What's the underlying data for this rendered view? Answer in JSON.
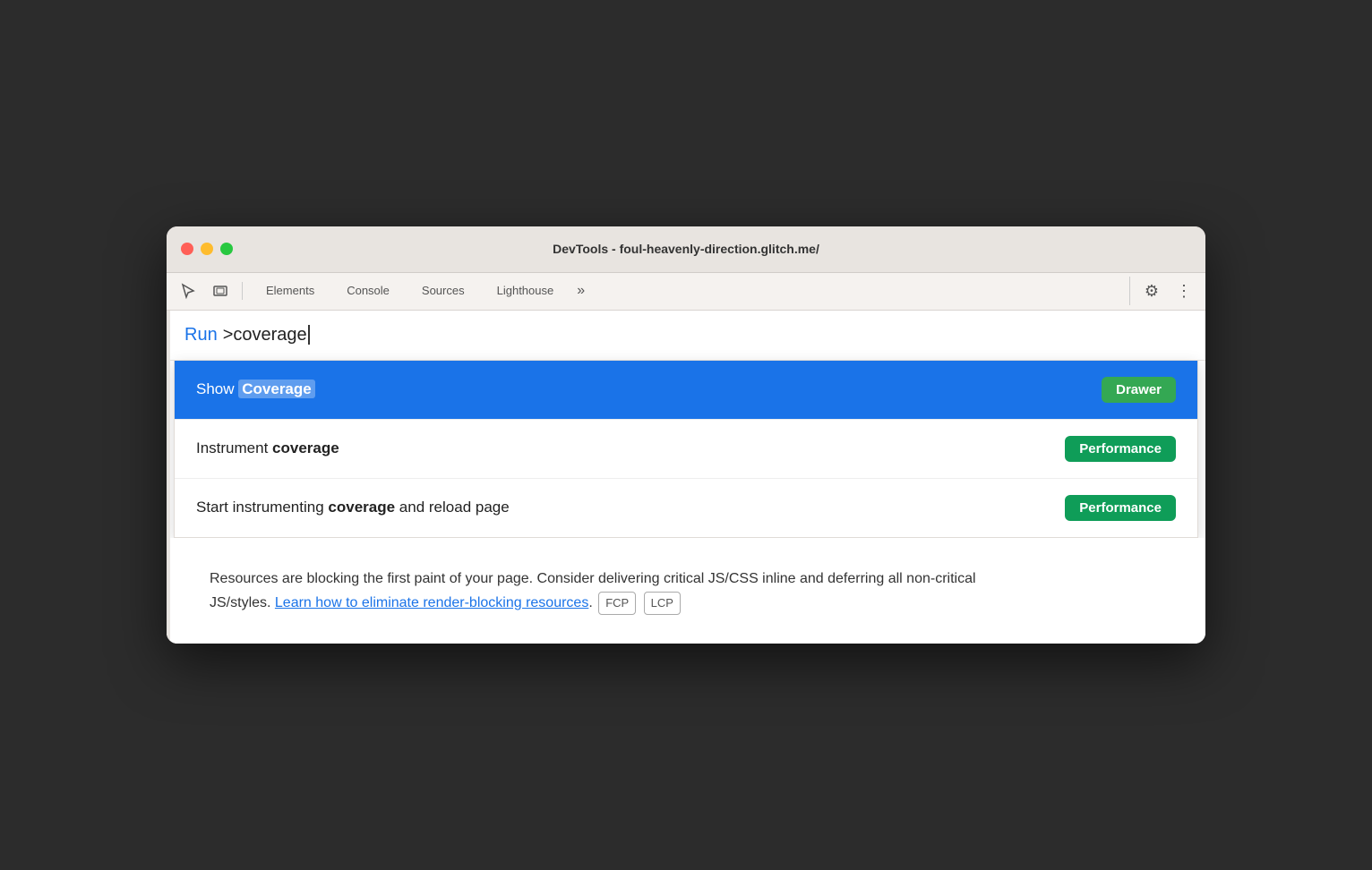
{
  "window": {
    "title": "DevTools - foul-heavenly-direction.glitch.me/"
  },
  "traffic_lights": {
    "red": "red",
    "yellow": "yellow",
    "green": "green"
  },
  "toolbar": {
    "tabs": [
      {
        "label": "Elements",
        "id": "elements"
      },
      {
        "label": "Console",
        "id": "console"
      },
      {
        "label": "Sources",
        "id": "sources"
      },
      {
        "label": "Lighthouse",
        "id": "lighthouse"
      }
    ],
    "more_icon": "»",
    "settings_icon": "⚙",
    "menu_icon": "⋮"
  },
  "command_bar": {
    "run_label": "Run",
    "query_text": ">coverage"
  },
  "dropdown": {
    "items": [
      {
        "id": "show-coverage",
        "text_before": "Show ",
        "text_highlight": "Coverage",
        "text_after": "",
        "badge_label": "Drawer",
        "badge_type": "drawer",
        "selected": true
      },
      {
        "id": "instrument-coverage",
        "text_before": "Instrument ",
        "text_bold": "coverage",
        "text_after": "",
        "badge_label": "Performance",
        "badge_type": "performance",
        "selected": false
      },
      {
        "id": "start-instrumenting",
        "text_before": "Start instrumenting ",
        "text_bold": "coverage",
        "text_after": " and reload page",
        "badge_label": "Performance",
        "badge_type": "performance",
        "selected": false
      }
    ]
  },
  "body": {
    "text_before_link": "Resources are blocking the first paint of your page. Consider delivering critical JS/CSS inline and deferring all non-critical JS/styles. ",
    "link_text": "Learn how to eliminate render-blocking resources",
    "text_after_link": ". ",
    "pills": [
      "FCP",
      "LCP"
    ]
  },
  "icons": {
    "cursor_tool": "⬚",
    "device_tool": "▭",
    "settings": "⚙",
    "more": "⋮",
    "chevron": "»"
  }
}
